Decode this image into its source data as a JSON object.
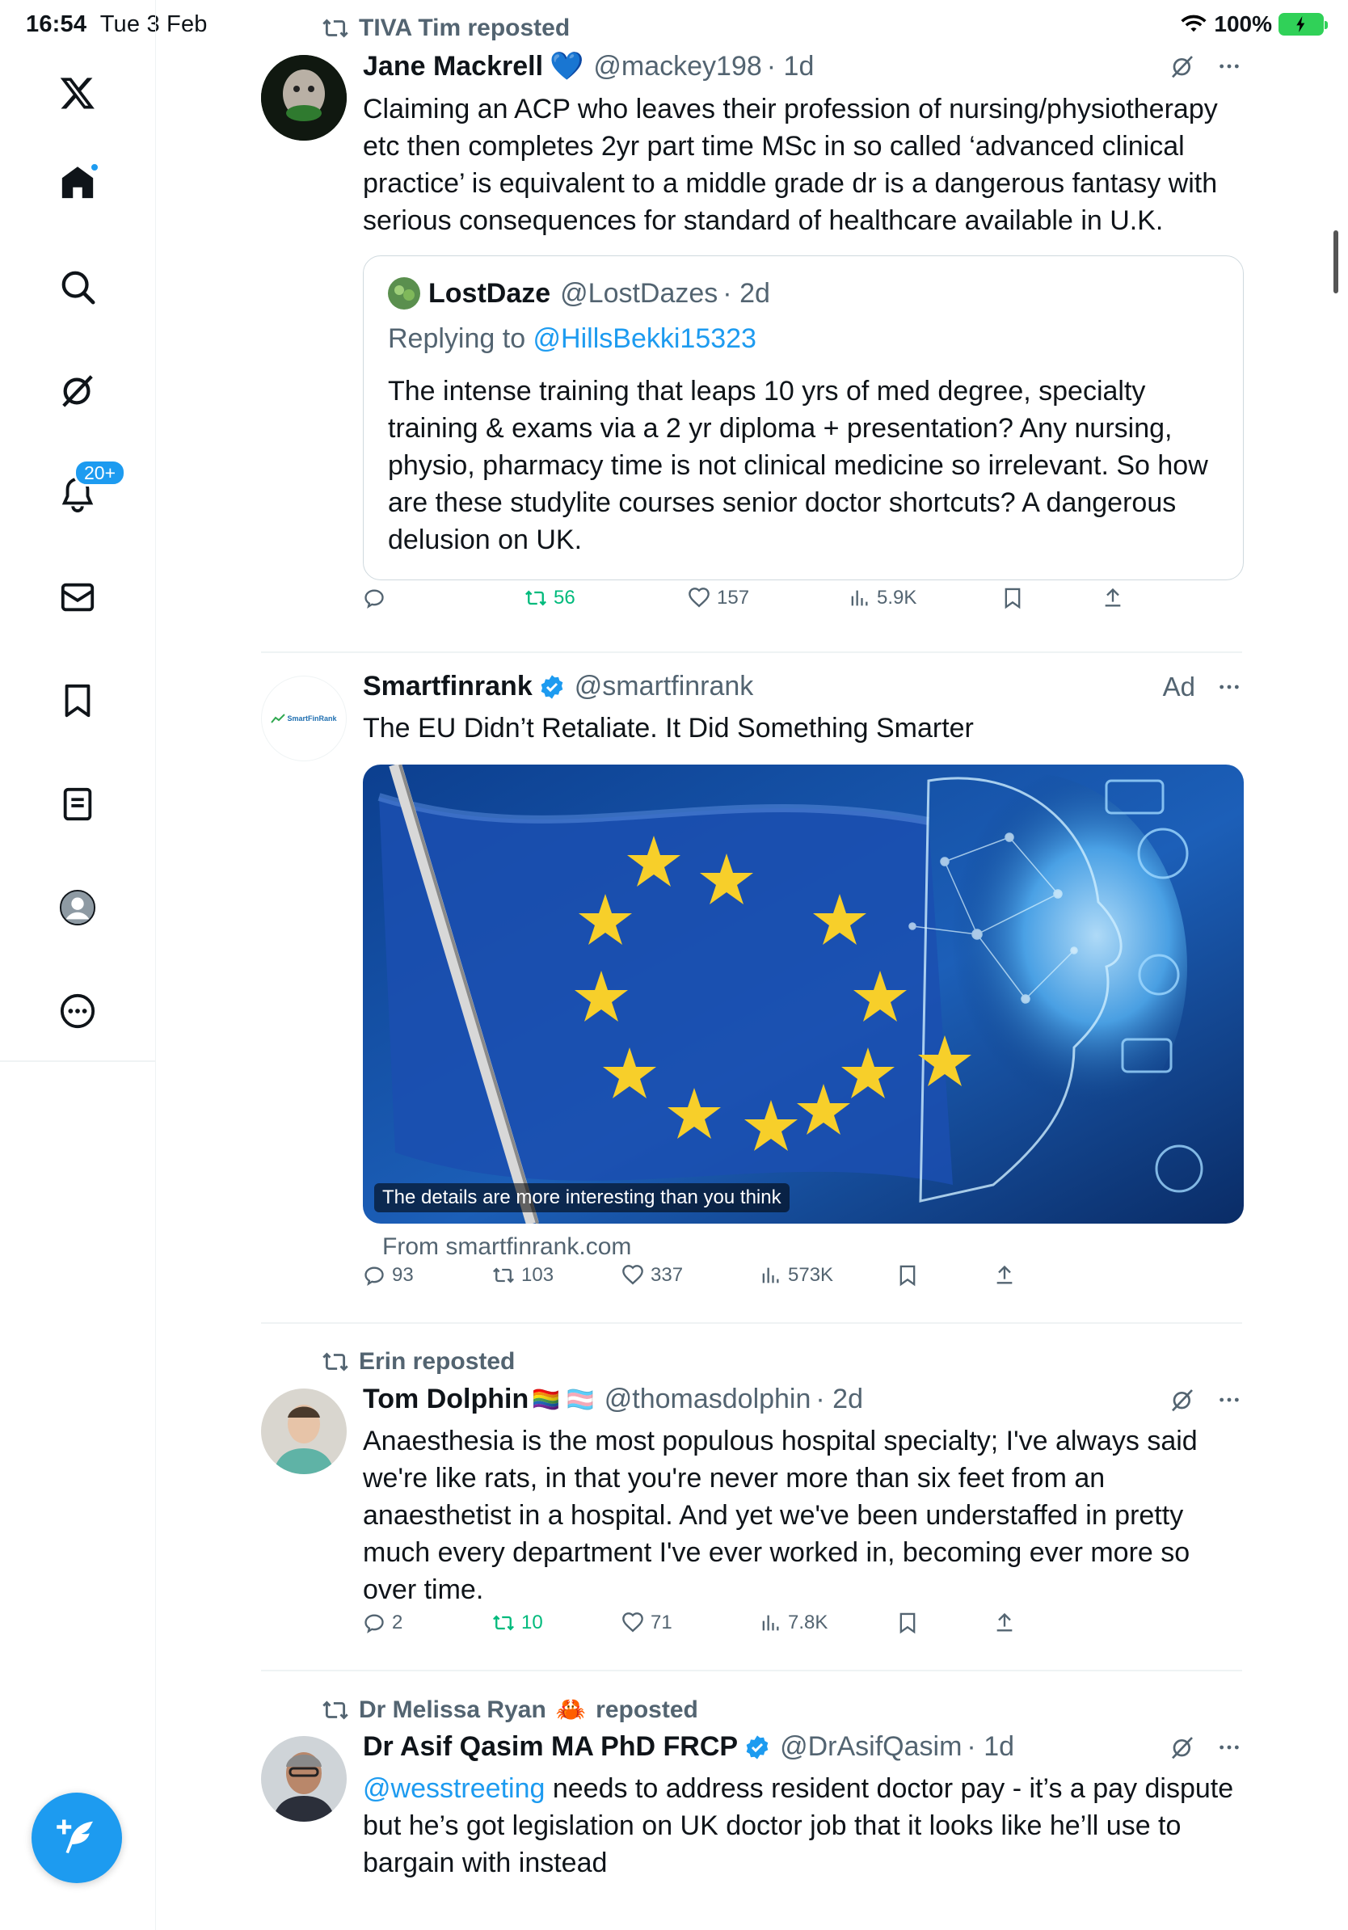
{
  "status_bar": {
    "time": "16:54",
    "date": "Tue 3 Feb",
    "battery": "100%"
  },
  "sidebar": {
    "items": [
      {
        "name": "logo",
        "icon": "x-logo-icon"
      },
      {
        "name": "home",
        "icon": "home-icon"
      },
      {
        "name": "explore",
        "icon": "search-icon"
      },
      {
        "name": "grok",
        "icon": "grok-icon"
      },
      {
        "name": "notifications",
        "icon": "bell-icon",
        "badge": "20+"
      },
      {
        "name": "messages",
        "icon": "mail-icon"
      },
      {
        "name": "bookmarks",
        "icon": "bookmark-icon"
      },
      {
        "name": "lists",
        "icon": "list-icon"
      },
      {
        "name": "profile",
        "icon": "profile-icon"
      },
      {
        "name": "more",
        "icon": "more-circle-icon"
      }
    ],
    "compose": {
      "icon": "compose-icon"
    }
  },
  "posts": [
    {
      "repost_by": "TIVA Tim reposted",
      "name": "Jane Mackrell",
      "name_emoji": "💙",
      "handle": "@mackey198",
      "time": "· 1d",
      "text": "Claiming an ACP who leaves their profession of nursing/physiotherapy etc then completes 2yr part time MSc in so called ‘advanced clinical practice’ is equivalent to a middle grade dr is a dangerous fantasy with serious  consequences for standard of healthcare available in U.K.",
      "quote": {
        "name": "LostDaze",
        "handle": "@LostDazes",
        "time": "· 2d",
        "reply_prefix": "Replying to ",
        "reply_to": "@HillsBekki15323",
        "text": "The intense training that leaps 10 yrs of med degree, specialty training & exams via a 2 yr diploma + presentation? Any nursing, physio, pharmacy time is not clinical medicine so irrelevant. So how are these studylite courses senior doctor shortcuts? A dangerous delusion on UK."
      },
      "replies": "",
      "reposts": "56",
      "likes": "157",
      "views": "5.9K"
    },
    {
      "name": "Smartfinrank",
      "handle": "@smartfinrank",
      "ad_label": "Ad",
      "avatar_text": "SmartFinRank",
      "text": "The EU Didn’t Retaliate. It Did Something Smarter",
      "image_caption": "The details are more interesting than you think",
      "from": "From smartfinrank.com",
      "replies": "93",
      "reposts": "103",
      "likes": "337",
      "views": "573K"
    },
    {
      "repost_by": "Erin reposted",
      "name": "Tom Dolphin",
      "name_emoji": "🏳️‍🌈 🏳️‍⚧️",
      "handle": "@thomasdolphin",
      "time": "· 2d",
      "text": "Anaesthesia is the most populous hospital specialty; I've always said we're like rats, in that you're never more than six feet from an anaesthetist in a hospital. And yet we've been understaffed in pretty much every department I've ever worked in, becoming ever more so over time.",
      "replies": "2",
      "reposts": "10",
      "likes": "71",
      "views": "7.8K"
    },
    {
      "repost_by_name": "Dr Melissa Ryan",
      "repost_by_emoji": "🦀",
      "repost_by_suffix": "reposted",
      "name": "Dr Asif Qasim MA PhD FRCP",
      "handle": "@DrAsifQasim",
      "time": "· 1d",
      "mention": "@wesstreeting",
      "text": " needs to address resident doctor pay - it’s a pay dispute but he’s got legislation on UK doctor job that it looks like he’ll use to bargain with instead"
    }
  ],
  "colors": {
    "accent": "#1d9bf0",
    "repost_green": "#00ba7c",
    "muted": "#536471"
  }
}
